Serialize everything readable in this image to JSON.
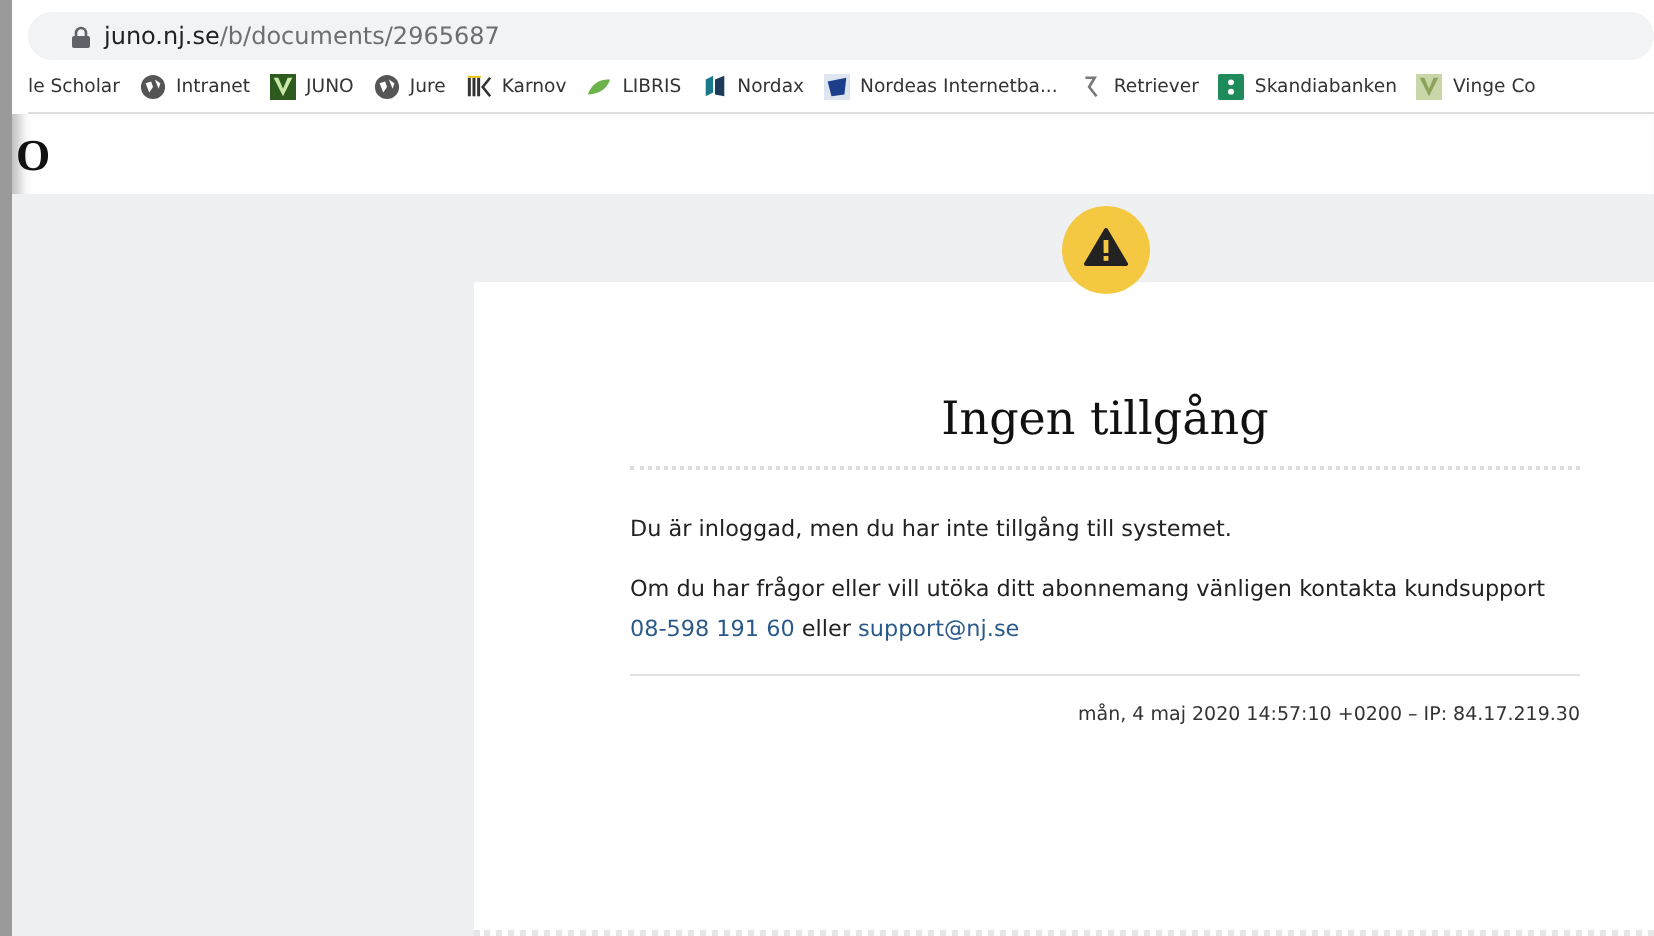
{
  "address_bar": {
    "host": "juno.nj.se",
    "path": "/b/documents/2965687"
  },
  "bookmarks": [
    {
      "label": "le Scholar",
      "kind": "none"
    },
    {
      "label": "Intranet",
      "kind": "globe"
    },
    {
      "label": "JUNO",
      "kind": "v-dark"
    },
    {
      "label": "Jure",
      "kind": "globe"
    },
    {
      "label": "Karnov",
      "kind": "bars"
    },
    {
      "label": "LIBRIS",
      "kind": "leaf"
    },
    {
      "label": "Nordax",
      "kind": "nordax"
    },
    {
      "label": "Nordeas Internetba...",
      "kind": "flag"
    },
    {
      "label": "Retriever",
      "kind": "hook"
    },
    {
      "label": "Skandiabanken",
      "kind": "dots"
    },
    {
      "label": "Vinge Co",
      "kind": "v-light"
    }
  ],
  "site_logo": "O",
  "card": {
    "title": "Ingen tillgång",
    "message": "Du är inloggad, men du har inte tillgång till systemet.",
    "contact_text": "Om du har frågor eller vill utöka ditt abonnemang vänligen kontakta kundsupport",
    "phone": "08-598 191 60",
    "joiner": "eller",
    "email": "support@nj.se",
    "meta": "mån, 4 maj 2020 14:57:10 +0200 – IP: 84.17.219.30"
  }
}
